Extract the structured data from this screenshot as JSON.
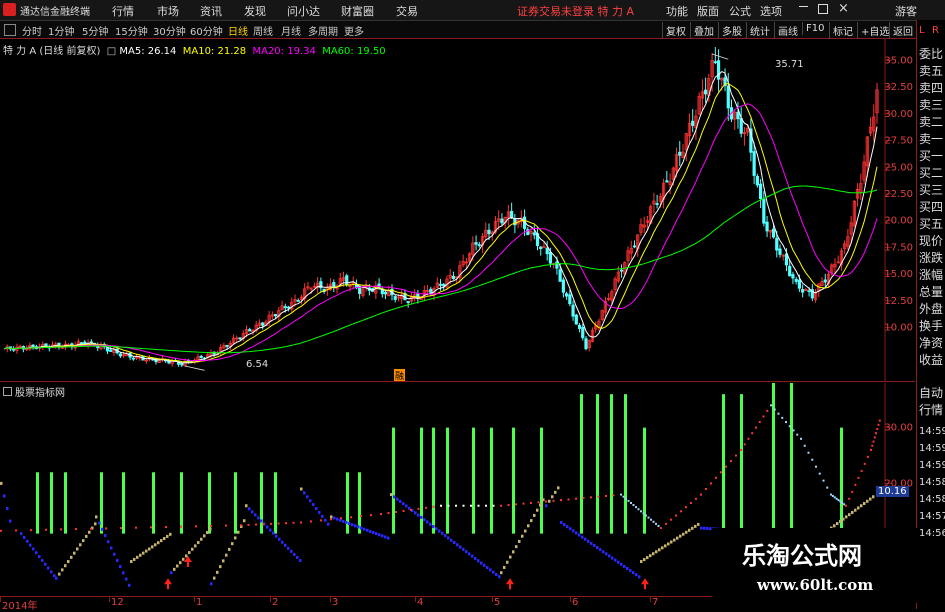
{
  "app": {
    "title": "通达信金融终端",
    "menu": [
      "行情",
      "市场",
      "资讯",
      "发现",
      "问小达",
      "财富圈",
      "交易"
    ],
    "notice": "证券交易未登录  特 力 A",
    "right_menu": [
      "功能",
      "版面",
      "公式",
      "选项",
      "游客"
    ]
  },
  "periods": [
    "分时",
    "1分钟",
    "5分钟",
    "15分钟",
    "30分钟",
    "60分钟",
    "日线",
    "周线",
    "月线",
    "多周期",
    "更多"
  ],
  "active_period": "日线",
  "toolbar": [
    "复权",
    "叠加",
    "多股",
    "统计",
    "画线",
    "F10",
    "标记",
    "+自选",
    "返回"
  ],
  "right_panel": {
    "top": [
      "L",
      "R"
    ],
    "items": [
      "委比",
      "卖五",
      "卖四",
      "卖三",
      "卖二",
      "卖一",
      "买一",
      "买二",
      "买三",
      "买四",
      "买五",
      "现价",
      "涨跌",
      "涨幅",
      "总量",
      "外盘",
      "换手",
      "净资",
      "收益"
    ],
    "items2": [
      "自动",
      "行情"
    ]
  },
  "main_legend": {
    "stock": "特 力 A (日线 前复权)",
    "ma5": "MA5: 26.14",
    "ma10": "MA10: 21.28",
    "ma20": "MA20: 19.34",
    "ma60": "MA60: 19.50"
  },
  "sub_legend": "股票指标网",
  "high_label": "35.71",
  "low_label": "6.54",
  "marker_label": "融",
  "sub_value": "10.16",
  "time_labels": [
    "14:59",
    "14:59",
    "14:59",
    "14:58",
    "14:58",
    "14:57",
    "14:56"
  ],
  "watermark": {
    "line1": "乐淘公式网",
    "line2": "www.60lt.com"
  },
  "colors": {
    "up": "#ff3232",
    "down": "#54ffff",
    "ma5": "#ffffff",
    "ma10": "#ffff00",
    "ma20": "#ff00ff",
    "ma60": "#00ff00"
  },
  "chart_data": [
    {
      "type": "candlestick",
      "title": "特 力 A (日线 前复权)",
      "ylim": [
        5,
        37
      ],
      "yticks": [
        "35.00",
        "32.50",
        "30.00",
        "27.50",
        "25.00",
        "22.50",
        "20.00",
        "17.50",
        "15.00",
        "12.50",
        "10.00"
      ],
      "x": [
        "2014年",
        "12",
        "1",
        "2",
        "3",
        "4",
        "5",
        "6",
        "7"
      ],
      "annotations": {
        "high": 35.71,
        "low": 6.54
      },
      "series": [
        {
          "name": "MA5",
          "value": 26.14
        },
        {
          "name": "MA10",
          "value": 21.28
        },
        {
          "name": "MA20",
          "value": 19.34
        },
        {
          "name": "MA60",
          "value": 19.5
        }
      ],
      "close_path": [
        [
          0,
          8.0
        ],
        [
          5,
          8.1
        ],
        [
          10,
          8.2
        ],
        [
          15,
          8.3
        ],
        [
          20,
          8.3
        ],
        [
          25,
          8.6
        ],
        [
          30,
          8.2
        ],
        [
          35,
          7.6
        ],
        [
          40,
          7.2
        ],
        [
          45,
          7.0
        ],
        [
          50,
          6.9
        ],
        [
          55,
          6.6
        ],
        [
          60,
          7.1
        ],
        [
          65,
          7.6
        ],
        [
          70,
          8.6
        ],
        [
          75,
          9.6
        ],
        [
          80,
          10.4
        ],
        [
          85,
          11.6
        ],
        [
          90,
          12.4
        ],
        [
          95,
          14.0
        ],
        [
          100,
          13.6
        ],
        [
          105,
          14.5
        ],
        [
          110,
          13.5
        ],
        [
          115,
          13.7
        ],
        [
          120,
          13.0
        ],
        [
          125,
          12.6
        ],
        [
          130,
          13.2
        ],
        [
          135,
          14.0
        ],
        [
          140,
          15.0
        ],
        [
          145,
          17.5
        ],
        [
          150,
          19.0
        ],
        [
          155,
          20.5
        ],
        [
          160,
          19.8
        ],
        [
          165,
          18.0
        ],
        [
          170,
          16.0
        ],
        [
          175,
          12.0
        ],
        [
          180,
          8.2
        ],
        [
          185,
          11.5
        ],
        [
          190,
          15.0
        ],
        [
          195,
          18.0
        ],
        [
          200,
          21.0
        ],
        [
          205,
          23.5
        ],
        [
          210,
          27.0
        ],
        [
          215,
          31.0
        ],
        [
          220,
          35.0
        ],
        [
          225,
          30.0
        ],
        [
          230,
          28.0
        ],
        [
          235,
          20.0
        ],
        [
          240,
          17.0
        ],
        [
          245,
          14.0
        ],
        [
          250,
          13.0
        ],
        [
          255,
          15.0
        ],
        [
          260,
          17.5
        ],
        [
          265,
          24.0
        ],
        [
          270,
          32.0
        ]
      ]
    },
    {
      "type": "bar",
      "title": "股票指标网",
      "ylim": [
        0,
        38
      ],
      "yticks": [
        "30.00",
        "20.00",
        "10.00"
      ],
      "value": 10.16
    }
  ]
}
